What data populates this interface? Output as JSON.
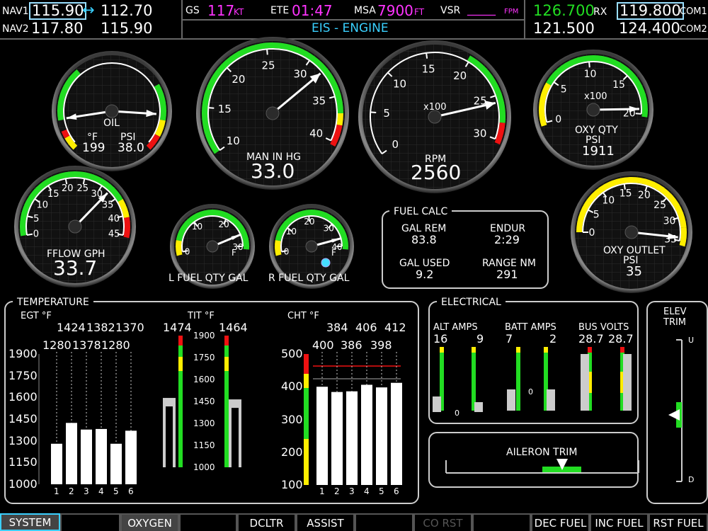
{
  "nav": {
    "nav1_label": "NAV1",
    "nav1_active": "115.90",
    "nav1_arrow": "↔",
    "nav1_standby": "112.70",
    "nav2_label": "NAV2",
    "nav2_active": "117.80",
    "nav2_standby": "115.90"
  },
  "status": {
    "gs_label": "GS",
    "gs_value": "117",
    "gs_unit": "KT",
    "ete_label": "ETE",
    "ete_value": "01:47",
    "msa_label": "MSA",
    "msa_value": "7900",
    "msa_unit": "FT",
    "vsr_label": "VSR",
    "vsr_value": "_____",
    "vsr_unit": "FPM",
    "page_title": "EIS - ENGINE"
  },
  "com": {
    "com1_active": "126.700",
    "com1_rx": "RX",
    "com1_standby": "119.800",
    "com1_label": "COM1",
    "com2_active": "121.500",
    "com2_standby": "124.400",
    "com2_label": "COM2"
  },
  "colors": {
    "cyan": "#3ad0ff",
    "magenta": "#ff33ff",
    "green": "#22dd22",
    "yellow": "#ffee00",
    "red": "#ee1111"
  },
  "gauges": {
    "oil": {
      "title": "OIL",
      "temp_unit": "°F",
      "psi_unit": "PSI",
      "temp_value": "199",
      "psi_value": "38.0"
    },
    "manifold": {
      "title": "MAN IN HG",
      "value": "33.0",
      "ticks": [
        "10",
        "15",
        "20",
        "25",
        "30",
        "35",
        "40"
      ]
    },
    "rpm": {
      "title": "RPM",
      "value": "2560",
      "multiplier": "x100",
      "ticks": [
        "0",
        "5",
        "10",
        "15",
        "20",
        "25",
        "30"
      ]
    },
    "oxy_qty": {
      "title": "OXY QTY",
      "unit": "PSI",
      "value": "1911",
      "multiplier": "x100",
      "ticks": [
        "0",
        "5",
        "10",
        "15",
        "20"
      ]
    },
    "fflow": {
      "title": "FFLOW GPH",
      "value": "33.7",
      "ticks": [
        "0",
        "5",
        "10",
        "15",
        "20",
        "25",
        "30",
        "35",
        "40",
        "45"
      ]
    },
    "l_fuel": {
      "title": "L FUEL QTY GAL",
      "ticks": [
        "0",
        "10",
        "20",
        "30",
        "40"
      ],
      "full": "F"
    },
    "r_fuel": {
      "title": "R FUEL QTY GAL",
      "ticks": [
        "0",
        "10",
        "20",
        "30",
        "40"
      ],
      "full": "F"
    },
    "oxy_outlet": {
      "title": "OXY OUTLET",
      "unit": "PSI",
      "value": "35",
      "ticks": [
        "0",
        "5",
        "10",
        "15",
        "20",
        "25",
        "30",
        "35"
      ]
    }
  },
  "fuel_calc": {
    "title": "FUEL CALC",
    "gal_rem_label": "GAL REM",
    "gal_rem": "83.8",
    "endur_label": "ENDUR",
    "endur": "2:29",
    "gal_used_label": "GAL USED",
    "gal_used": "9.2",
    "range_label": "RANGE NM",
    "range": "291"
  },
  "temperature": {
    "title": "TEMPERATURE",
    "egt_label": "EGT °F",
    "egt_scale": [
      "1900",
      "1750",
      "1600",
      "1450",
      "1300",
      "1150",
      "1000"
    ],
    "egt_values_top": [
      "1424",
      "1382",
      "1370"
    ],
    "egt_values_bottom": [
      "1280",
      "1378",
      "1280"
    ],
    "cylinders": [
      "1",
      "2",
      "3",
      "4",
      "5",
      "6"
    ],
    "egt_levels": [
      1280,
      1424,
      1378,
      1382,
      1280,
      1370
    ],
    "tit_label": "TIT °F",
    "tit_scale": [
      "1900",
      "1750",
      "1600",
      "1450",
      "1300",
      "1150",
      "1000"
    ],
    "tit_left": "1474",
    "tit_right": "1464",
    "tit_levels": [
      1474,
      1464
    ],
    "cht_label": "CHT °F",
    "cht_scale": [
      "500",
      "400",
      "300",
      "200",
      "100"
    ],
    "cht_values_top": [
      "384",
      "406",
      "412"
    ],
    "cht_values_bottom": [
      "400",
      "386",
      "398"
    ],
    "cht_levels": [
      400,
      384,
      386,
      406,
      398,
      412
    ]
  },
  "electrical": {
    "title": "ELECTRICAL",
    "alt_label": "ALT AMPS",
    "alt_1": "16",
    "alt_2": "9",
    "alt_zero": "0",
    "batt_label": "BATT AMPS",
    "batt_1": "7",
    "batt_2": "2",
    "batt_zero": "0",
    "bus_label": "BUS VOLTS",
    "bus_1": "28.7",
    "bus_2": "28.7"
  },
  "trim": {
    "elev_title_1": "ELEV",
    "elev_title_2": "TRIM",
    "elev_up": "U",
    "elev_down": "D",
    "aileron_title": "AILERON TRIM"
  },
  "softkeys": {
    "system": "SYSTEM",
    "oxygen": "OXYGEN",
    "dcltr": "DCLTR",
    "assist": "ASSIST",
    "co_rst": "CO RST",
    "dec_fuel": "DEC FUEL",
    "inc_fuel": "INC FUEL",
    "rst_fuel": "RST FUEL"
  }
}
